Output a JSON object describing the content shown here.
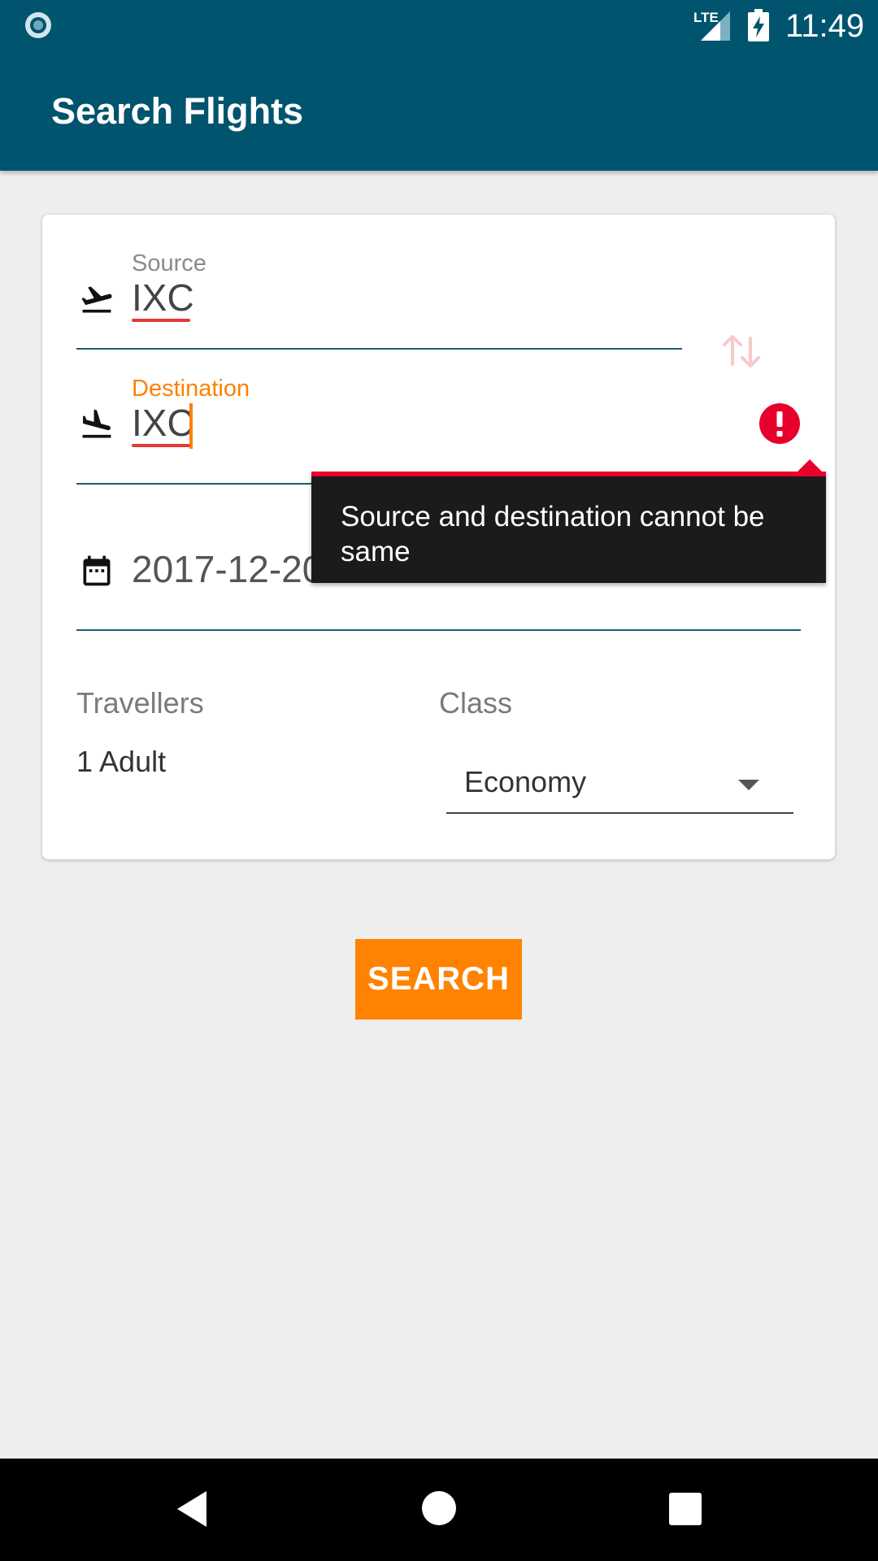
{
  "status_bar": {
    "network": "LTE",
    "time": "11:49"
  },
  "app_bar": {
    "title": "Search Flights"
  },
  "form": {
    "source": {
      "label": "Source",
      "value": "IXC"
    },
    "destination": {
      "label": "Destination",
      "value": "IXC"
    },
    "date": {
      "value": "2017-12-20"
    },
    "error_message": "Source and destination cannot be same",
    "travellers": {
      "label": "Travellers",
      "value": "1 Adult"
    },
    "class": {
      "label": "Class",
      "selected": "Economy"
    }
  },
  "actions": {
    "search_label": "SEARCH"
  },
  "colors": {
    "primary": "#00546e",
    "accent": "#ff8300",
    "error": "#e8002c",
    "tooltip_bg": "#1b1b1b"
  },
  "icons": [
    "record-icon",
    "signal-icon",
    "battery-charging-icon",
    "takeoff-icon",
    "landing-icon",
    "swap-icon",
    "error-icon",
    "calendar-icon",
    "dropdown-arrow-icon",
    "nav-back-icon",
    "nav-home-icon",
    "nav-recent-icon"
  ]
}
